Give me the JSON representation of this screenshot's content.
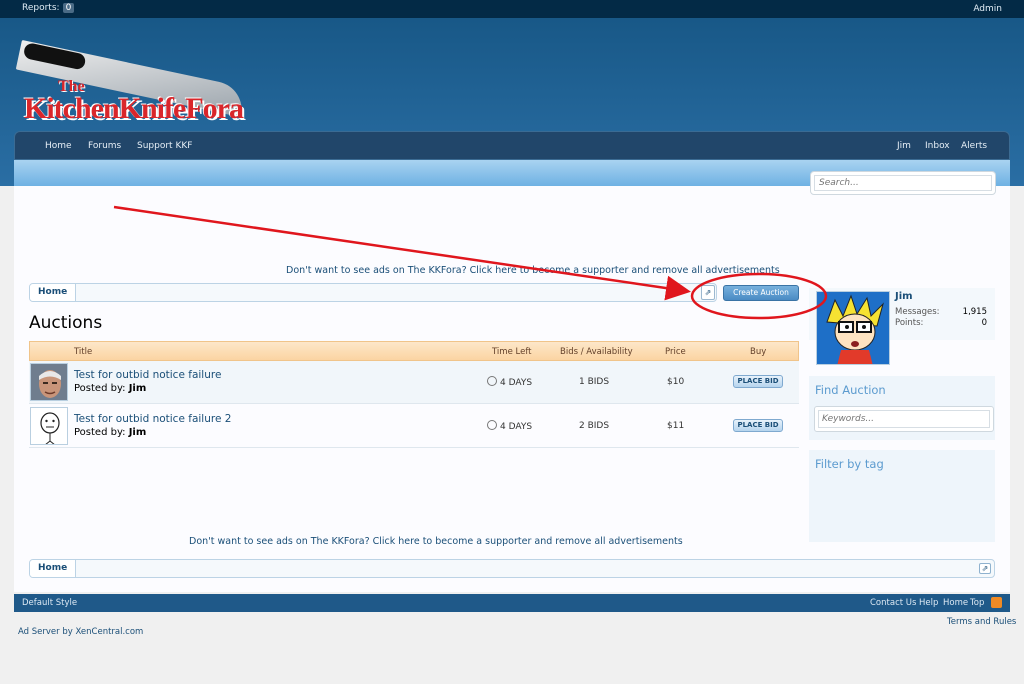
{
  "topbar": {
    "reports_label": "Reports:",
    "reports_count": "0",
    "admin": "Admin"
  },
  "logo": {
    "line1": "The",
    "line2": "KitchenKnifeFora"
  },
  "nav": {
    "home": "Home",
    "forums": "Forums",
    "support": "Support KKF",
    "user": "Jim",
    "inbox": "Inbox",
    "alerts": "Alerts"
  },
  "search": {
    "placeholder": "Search..."
  },
  "ad_message": "Don't want to see ads on The KKFora? Click here to become a supporter and remove all advertisements",
  "breadcrumb": {
    "home": "Home"
  },
  "create_button": "Create Auction",
  "page_title": "Auctions",
  "table": {
    "headers": {
      "title": "Title",
      "time_left": "Time Left",
      "bids": "Bids / Availability",
      "price": "Price",
      "buy": "Buy"
    },
    "rows": [
      {
        "title": "Test for outbid notice failure",
        "posted_label": "Posted by:",
        "author": "Jim",
        "time_left": "4 DAYS",
        "bids": "1 BIDS",
        "price": "$10",
        "action": "PLACE BID"
      },
      {
        "title": "Test for outbid notice failure 2",
        "posted_label": "Posted by:",
        "author": "Jim",
        "time_left": "4 DAYS",
        "bids": "2 BIDS",
        "price": "$11",
        "action": "PLACE BID"
      }
    ]
  },
  "visitor": {
    "name": "Jim",
    "messages_label": "Messages:",
    "messages": "1,915",
    "points_label": "Points:",
    "points": "0"
  },
  "find_auction": {
    "title": "Find Auction",
    "placeholder": "Keywords..."
  },
  "filter_tag": {
    "title": "Filter by tag"
  },
  "footer": {
    "style": "Default Style",
    "contact": "Contact Us",
    "help": "Help",
    "home": "Home",
    "top": "Top"
  },
  "ad_server": "Ad Server by XenCentral.com",
  "terms": "Terms and Rules",
  "colors": {
    "header": "#185887",
    "accent_red": "#e0161d",
    "link": "#1b4f78"
  }
}
